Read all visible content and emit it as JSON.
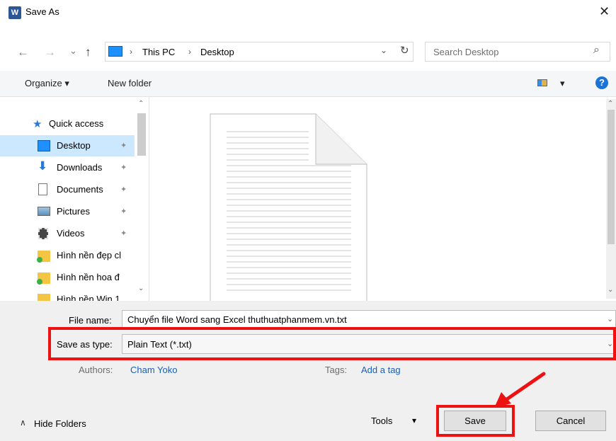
{
  "window": {
    "title": "Save As",
    "app_icon_letter": "W",
    "close_glyph": "✕"
  },
  "nav_buttons": {
    "back": "←",
    "forward": "→",
    "recent": "⌄",
    "up": "↑"
  },
  "address": {
    "crumbs": [
      "This PC",
      "Desktop"
    ],
    "refresh": "↻",
    "dropdown": "⌄"
  },
  "search": {
    "placeholder": "Search Desktop",
    "icon": "⌕"
  },
  "toolbar": {
    "organize": "Organize ▾",
    "new_folder": "New folder",
    "view_dd": "▾",
    "help": "?"
  },
  "nav_pane": {
    "items": [
      {
        "label": "Quick access",
        "icon": "star-icon",
        "pinned": false
      },
      {
        "label": "Desktop",
        "icon": "desktop-icon",
        "pinned": true,
        "selected": true
      },
      {
        "label": "Downloads",
        "icon": "download-icon",
        "pinned": true
      },
      {
        "label": "Documents",
        "icon": "documents-icon",
        "pinned": true
      },
      {
        "label": "Pictures",
        "icon": "pictures-icon",
        "pinned": true
      },
      {
        "label": "Videos",
        "icon": "videos-icon",
        "pinned": true
      },
      {
        "label": "Hình nền đẹp cl",
        "icon": "folder-icon",
        "pinned": false
      },
      {
        "label": "Hình nền hoa đ",
        "icon": "folder-icon",
        "pinned": false
      },
      {
        "label": "Hình nền Win 1",
        "icon": "folder-icon",
        "pinned": false
      }
    ],
    "pin_glyph": "✦"
  },
  "form": {
    "file_name_label": "File name:",
    "file_name_value": "Chuyển file Word sang Excel thuthuatphanmem.vn.txt",
    "save_type_label": "Save as type:",
    "save_type_value": "Plain Text (*.txt)",
    "authors_label": "Authors:",
    "authors_value": "Cham Yoko",
    "tags_label": "Tags:",
    "tags_value": "Add a tag"
  },
  "footer": {
    "hide_folders": "Hide Folders",
    "hide_glyph": "∧",
    "tools": "Tools",
    "tools_dd": "▾",
    "save": "Save",
    "cancel": "Cancel"
  },
  "colors": {
    "highlight_red": "#ee1111",
    "selection": "#cce8ff",
    "link_blue": "#1a5fb4"
  }
}
